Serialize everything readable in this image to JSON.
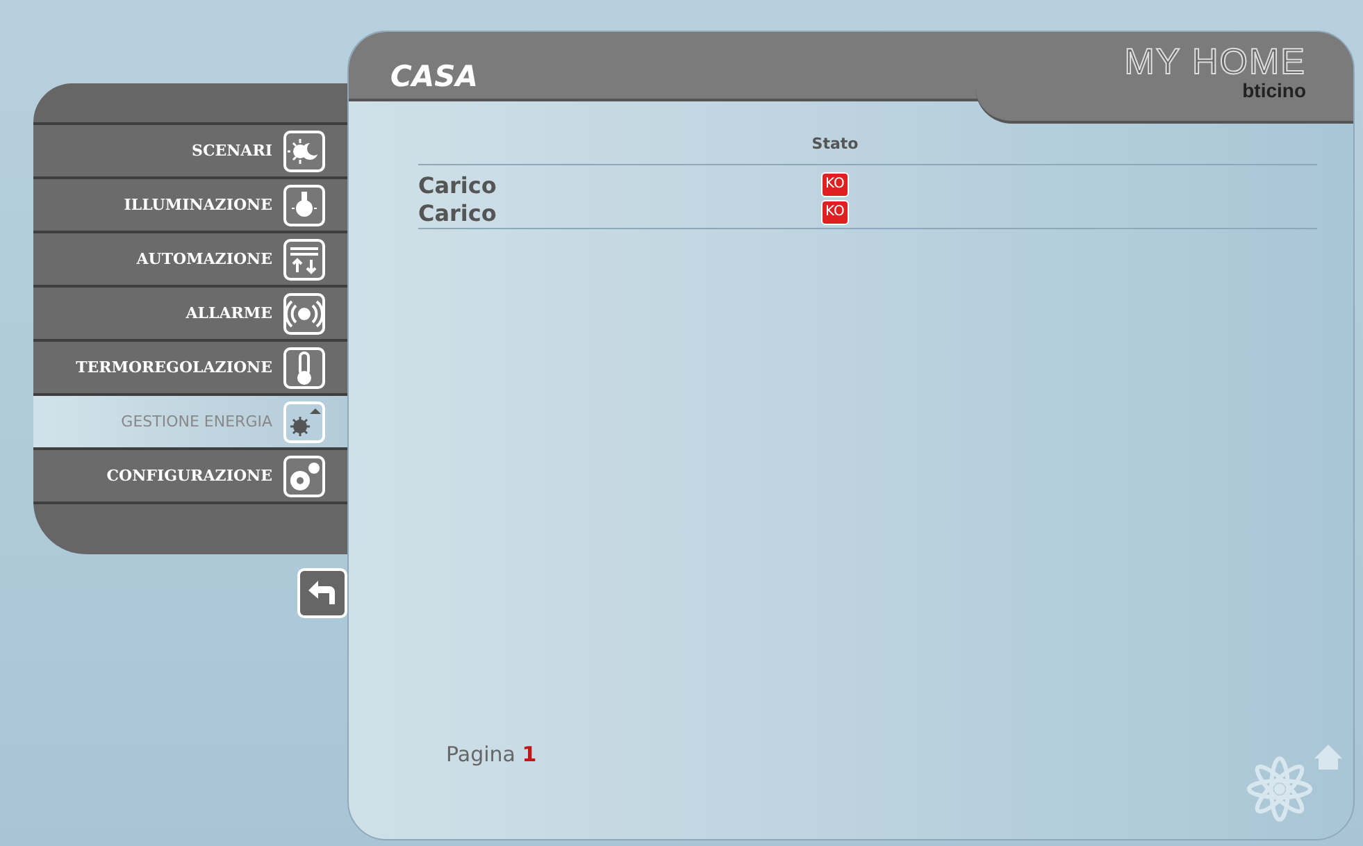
{
  "header": {
    "title": "CASA",
    "logo": "MY HOME",
    "brand": "bticino"
  },
  "menu": [
    {
      "label": "SCENARI",
      "kind": "scene",
      "selected": false
    },
    {
      "label": "ILLUMINAZIONE",
      "kind": "bulb",
      "selected": false
    },
    {
      "label": "AUTOMAZIONE",
      "kind": "shutter",
      "selected": false
    },
    {
      "label": "ALLARME",
      "kind": "alarm",
      "selected": false
    },
    {
      "label": "TERMOREGOLAZIONE",
      "kind": "thermo",
      "selected": false
    },
    {
      "label": "GESTIONE ENERGIA",
      "kind": "energy",
      "selected": true
    },
    {
      "label": "CONFIGURAZIONE",
      "kind": "gears",
      "selected": false
    }
  ],
  "table": {
    "columns": [
      "Stato"
    ],
    "rows": [
      {
        "label": "Carico",
        "status": "KO"
      },
      {
        "label": "Carico",
        "status": "KO"
      }
    ]
  },
  "pagination": {
    "label": "Pagina",
    "page": "1"
  }
}
